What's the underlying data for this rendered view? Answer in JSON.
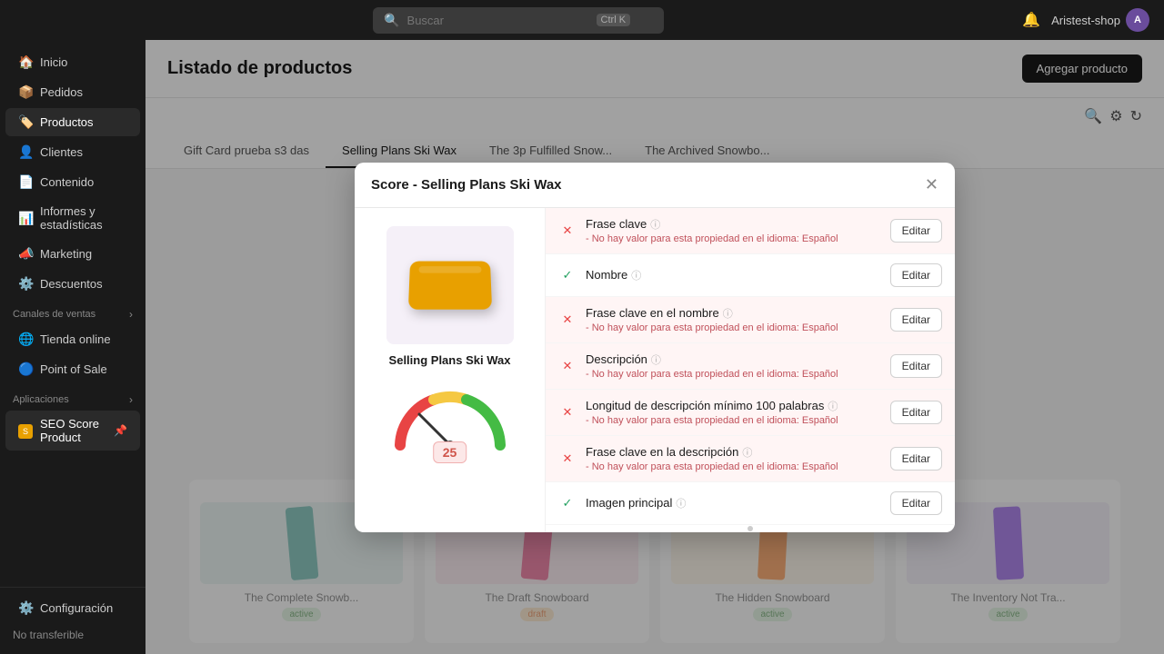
{
  "topbar": {
    "search_placeholder": "Buscar",
    "shortcut": "Ctrl K",
    "bell_icon": "🔔",
    "username": "Aristest-shop",
    "avatar_text": "A"
  },
  "sidebar": {
    "items": [
      {
        "label": "Inicio",
        "icon": "🏠"
      },
      {
        "label": "Pedidos",
        "icon": "📦"
      },
      {
        "label": "Productos",
        "icon": "🏷️"
      },
      {
        "label": "Clientes",
        "icon": "👤"
      },
      {
        "label": "Contenido",
        "icon": "📄"
      },
      {
        "label": "Informes y estadísticas",
        "icon": "📊"
      },
      {
        "label": "Marketing",
        "icon": "📣"
      },
      {
        "label": "Descuentos",
        "icon": "⚙️"
      }
    ],
    "sales_channels": "Canales de ventas",
    "channels": [
      {
        "label": "Tienda online",
        "icon": "🌐"
      },
      {
        "label": "Point of Sale",
        "icon": "🔵"
      }
    ],
    "apps_header": "Aplicaciones",
    "app_item": "SEO Score Product",
    "config_label": "Configuración",
    "no_transfer_label": "No transferible"
  },
  "page": {
    "title": "Listado de productos",
    "add_button": "Agregar producto"
  },
  "tabs": [
    {
      "label": "Gift Card prueba s3 das"
    },
    {
      "label": "Selling Plans Ski Wax"
    },
    {
      "label": "The 3p Fulfilled Snow..."
    },
    {
      "label": "The Archived Snowbo..."
    }
  ],
  "modal": {
    "title": "Score - Selling Plans Ski Wax",
    "close_icon": "✕",
    "product_name": "Selling Plans Ski Wax",
    "score_value": "25",
    "rows": [
      {
        "id": "frase-clave",
        "status": "fail",
        "label": "Frase clave",
        "sublabel": "- No hay valor para esta propiedad en el idioma: Español",
        "edit_label": "Editar"
      },
      {
        "id": "nombre",
        "status": "pass",
        "label": "Nombre",
        "sublabel": "",
        "edit_label": "Editar"
      },
      {
        "id": "frase-clave-nombre",
        "status": "fail",
        "label": "Frase clave en el nombre",
        "sublabel": "- No hay valor para esta propiedad en el idioma: Español",
        "edit_label": "Editar"
      },
      {
        "id": "descripcion",
        "status": "fail",
        "label": "Descripción",
        "sublabel": "- No hay valor para esta propiedad en el idioma: Español",
        "edit_label": "Editar"
      },
      {
        "id": "longitud-descripcion",
        "status": "fail",
        "label": "Longitud de descripción mínimo 100 palabras",
        "sublabel": "- No hay valor para esta propiedad en el idioma: Español",
        "edit_label": "Editar"
      },
      {
        "id": "frase-clave-descripcion",
        "status": "fail",
        "label": "Frase clave en la descripción",
        "sublabel": "- No hay valor para esta propiedad en el idioma: Español",
        "edit_label": "Editar"
      },
      {
        "id": "imagen-principal",
        "status": "pass",
        "label": "Imagen principal",
        "sublabel": "",
        "edit_label": "Editar"
      }
    ]
  },
  "bottom_products": [
    {
      "label": "The Complete Snowb...",
      "badge": "active",
      "color": "#2a9d8f"
    },
    {
      "label": "The Draft Snowboard",
      "badge": "draft",
      "color": "#e91e63"
    },
    {
      "label": "The Hidden Snowboard",
      "badge": "active",
      "color": "#ff6d00"
    },
    {
      "label": "The Inventory Not Tra...",
      "badge": "active",
      "color": "#6a1de4"
    }
  ]
}
